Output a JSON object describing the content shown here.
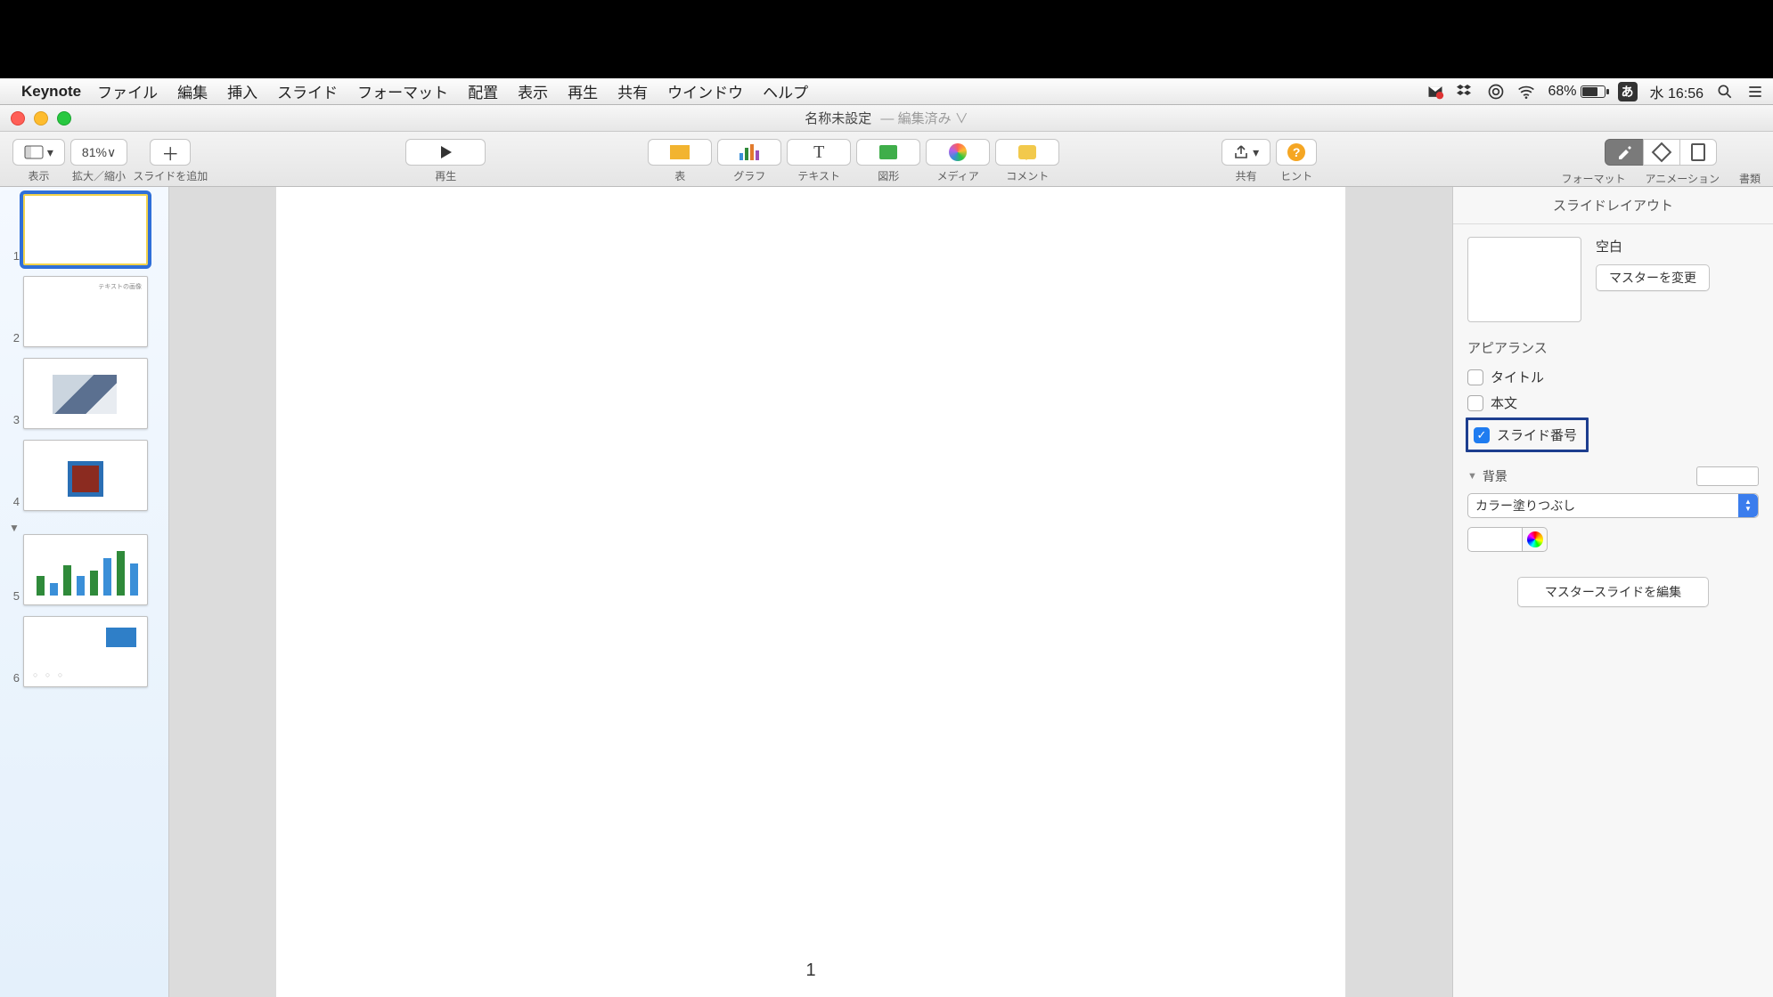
{
  "menubar": {
    "app": "Keynote",
    "items": [
      "ファイル",
      "編集",
      "挿入",
      "スライド",
      "フォーマット",
      "配置",
      "表示",
      "再生",
      "共有",
      "ウインドウ",
      "ヘルプ"
    ],
    "battery": "68%",
    "ime": "あ",
    "clock": "水 16:56"
  },
  "window": {
    "title": "名称未設定",
    "subtitle": "— 編集済み ∨"
  },
  "toolbar": {
    "view": "表示",
    "zoom": "81%∨",
    "zoom_label": "拡大／縮小",
    "add_slide": "スライドを追加",
    "play": "再生",
    "table": "表",
    "chart": "グラフ",
    "text": "テキスト",
    "shape": "図形",
    "media": "メディア",
    "comment": "コメント",
    "share": "共有",
    "hint": "ヒント",
    "format": "フォーマット",
    "animation": "アニメーション",
    "document": "書類"
  },
  "slides": {
    "count": 6,
    "selected": 1
  },
  "canvas": {
    "slide_number": "1"
  },
  "inspector": {
    "layout_tab": "スライドレイアウト",
    "layout_name": "空白",
    "change_master": "マスターを変更",
    "appearance": "アピアランス",
    "title_chk": "タイトル",
    "body_chk": "本文",
    "number_chk": "スライド番号",
    "background": "背景",
    "fill_type": "カラー塗りつぶし",
    "edit_master": "マスタースライドを編集"
  }
}
